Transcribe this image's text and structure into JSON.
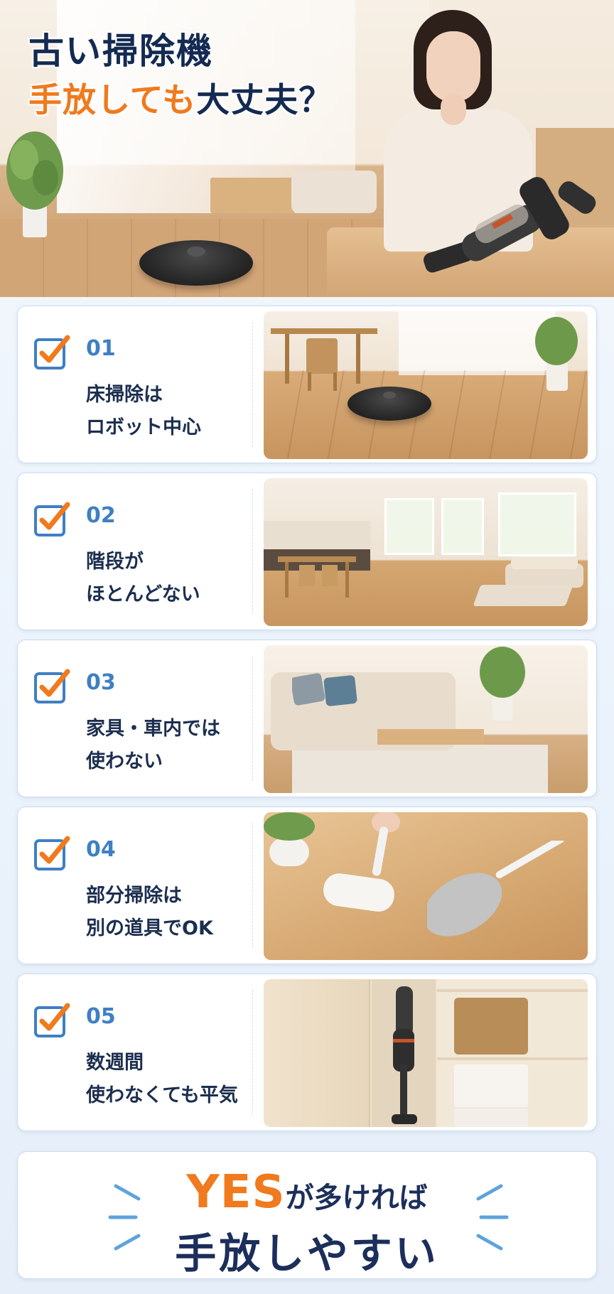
{
  "hero": {
    "title_line1": "古い掃除機",
    "title_line2_accent": "手放しても",
    "title_line2_rest": "大丈夫？"
  },
  "items": [
    {
      "number": "01",
      "line1": "床掃除は",
      "line2": "ロボット中心",
      "icon": "check-icon"
    },
    {
      "number": "02",
      "line1": "階段が",
      "line2": "ほとんどない",
      "icon": "check-icon"
    },
    {
      "number": "03",
      "line1": "家具・車内では",
      "line2": "使わない",
      "icon": "check-icon"
    },
    {
      "number": "04",
      "line1": "部分掃除は",
      "line2": "別の道具でOK",
      "icon": "check-icon"
    },
    {
      "number": "05",
      "line1": "数週間",
      "line2": "使わなくても平気",
      "icon": "check-icon"
    }
  ],
  "conclusion": {
    "yes": "YES",
    "line1_rest": "が多ければ",
    "line2": "手放しやすい"
  },
  "colors": {
    "navy": "#142a52",
    "orange": "#f07a1d",
    "accent_blue": "#3f7fc4"
  }
}
